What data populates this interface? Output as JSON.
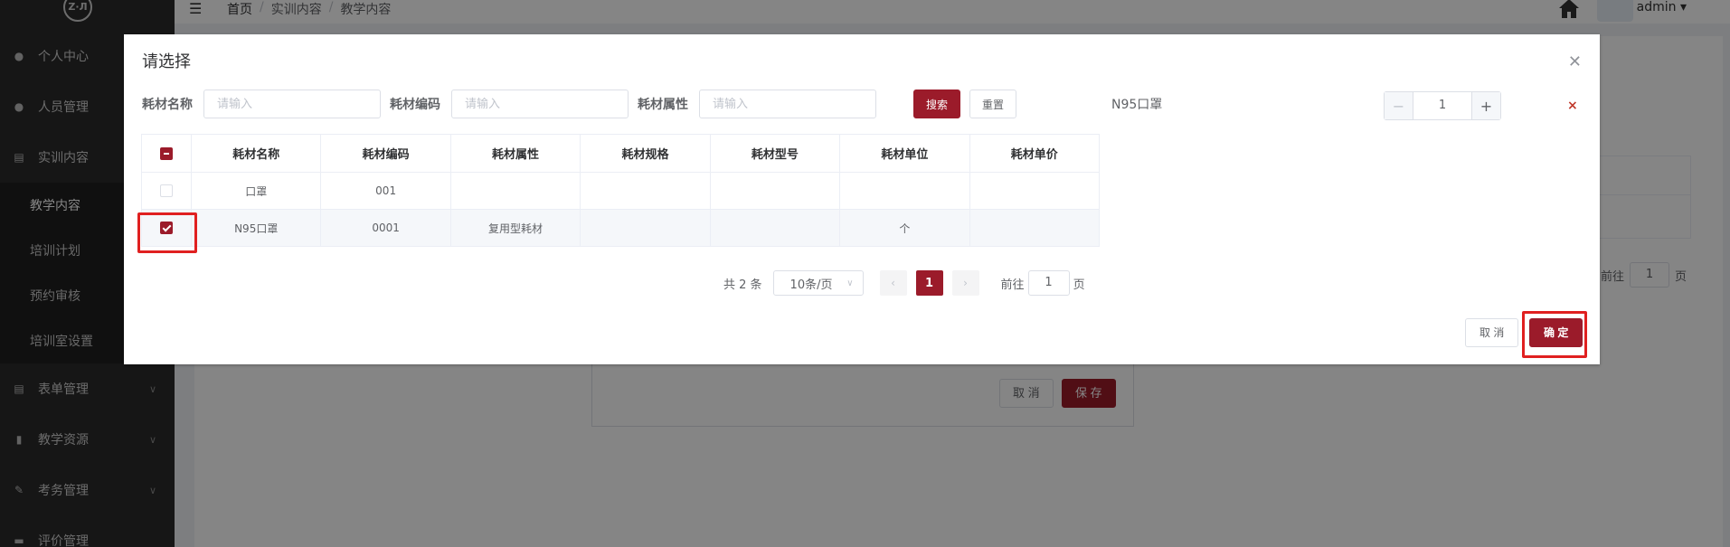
{
  "sidebar": {
    "logo_text": "Z·Л",
    "items": [
      {
        "label": "个人中心",
        "icon": "user-icon"
      },
      {
        "label": "人员管理",
        "icon": "users-icon"
      },
      {
        "label": "实训内容",
        "icon": "document-icon"
      },
      {
        "label": "表单管理",
        "icon": "form-icon"
      },
      {
        "label": "教学资源",
        "icon": "book-icon"
      },
      {
        "label": "考务管理",
        "icon": "exam-icon"
      },
      {
        "label": "评价管理",
        "icon": "rating-icon"
      }
    ],
    "subitems": [
      {
        "label": "教学内容",
        "active": true
      },
      {
        "label": "培训计划"
      },
      {
        "label": "预约审核"
      },
      {
        "label": "培训室设置"
      }
    ]
  },
  "topbar": {
    "breadcrumb": [
      "首页",
      "实训内容",
      "教学内容"
    ],
    "user": "admin"
  },
  "background": {
    "pager_goto": "前往",
    "pager_page": "1",
    "pager_unit": "页",
    "cancel": "取 消",
    "save": "保 存"
  },
  "dialog": {
    "title": "请选择",
    "search": {
      "name_label": "耗材名称",
      "code_label": "耗材编码",
      "attr_label": "耗材属性",
      "placeholder": "请输入",
      "search_btn": "搜索",
      "reset_btn": "重置"
    },
    "table": {
      "headers": [
        "耗材名称",
        "耗材编码",
        "耗材属性",
        "耗材规格",
        "耗材型号",
        "耗材单位",
        "耗材单价"
      ],
      "rows": [
        {
          "checked": false,
          "cells": [
            "口罩",
            "001",
            "",
            "",
            "",
            "",
            ""
          ]
        },
        {
          "checked": true,
          "cells": [
            "N95口罩",
            "0001",
            "复用型耗材",
            "",
            "",
            "个",
            ""
          ]
        }
      ]
    },
    "pager": {
      "total": "共 2 条",
      "page_size": "10条/页",
      "current": "1",
      "goto_label": "前往",
      "goto_value": "1",
      "unit": "页"
    },
    "selected": {
      "name": "N95口罩",
      "quantity": "1"
    },
    "cancel": "取 消",
    "confirm": "确 定"
  },
  "colors": {
    "primary": "#9b1b2a",
    "highlight": "#e02020",
    "sidebar": "#2b2b2b"
  }
}
